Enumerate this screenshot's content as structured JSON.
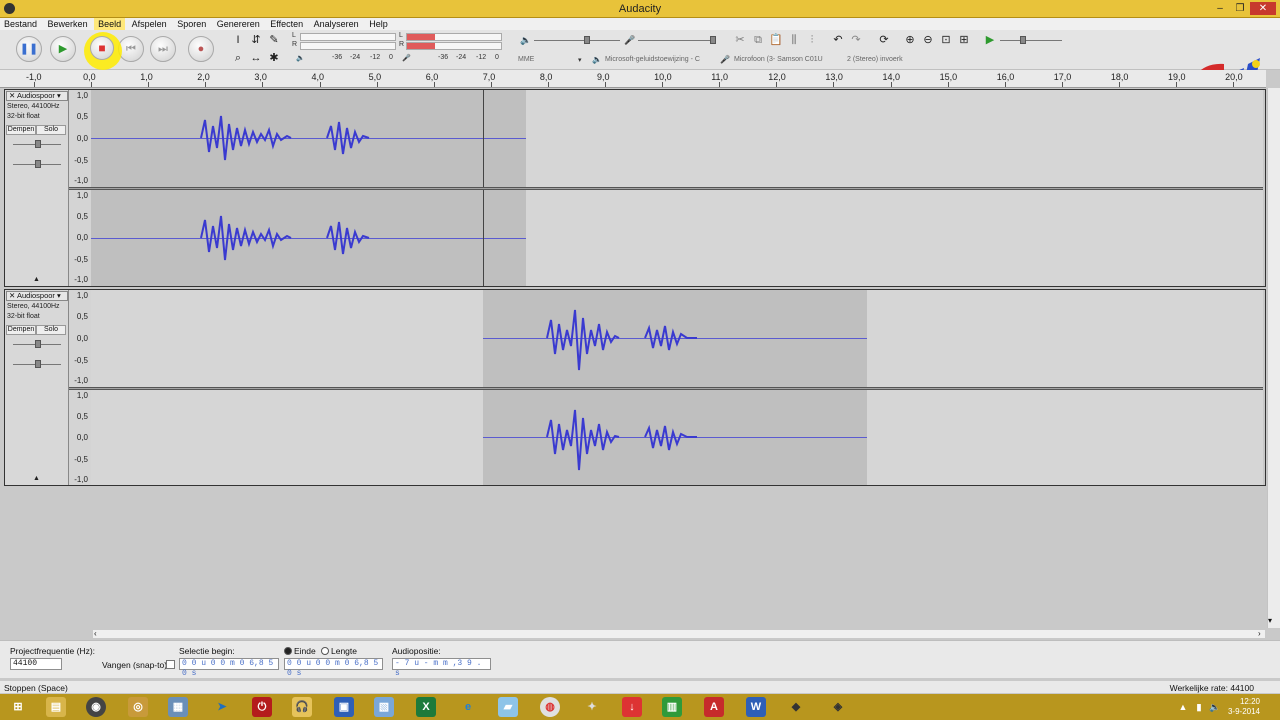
{
  "window": {
    "title": "Audacity",
    "minimize": "–",
    "maximize": "❐",
    "close": "✕"
  },
  "menu": [
    "Bestand",
    "Bewerken",
    "Beeld",
    "Afspelen",
    "Sporen",
    "Genereren",
    "Effecten",
    "Analyseren",
    "Help"
  ],
  "meters": {
    "playback": {
      "left": "L",
      "right": "R"
    },
    "record": {
      "left": "L",
      "right": "R"
    },
    "scale_a": [
      "-36",
      "-24",
      "-12",
      "0"
    ],
    "scale_b": [
      "-36",
      "-24",
      "-12",
      "0"
    ]
  },
  "devices": {
    "host": "MME",
    "output": "Microsoft-geluidstoewijzing - C",
    "input": "Microfoon (3- Samson C01U",
    "channels": "2 (Stereo) invoerk"
  },
  "ruler_ticks": [
    "-1,0",
    "0,0",
    "1,0",
    "2,0",
    "3,0",
    "4,0",
    "5,0",
    "6,0",
    "7,0",
    "8,0",
    "9,0",
    "10,0",
    "11,0",
    "12,0",
    "13,0",
    "14,0",
    "15,0",
    "16,0",
    "17,0",
    "18,0",
    "19,0",
    "20,0"
  ],
  "tracks": [
    {
      "name": "Audiospoor",
      "rate": "Stereo, 44100Hz",
      "format": "32-bit float",
      "mute": "Dempen",
      "solo": "Solo",
      "scale": [
        "1,0",
        "0,5",
        "0,0",
        "-0,5",
        "-1,0"
      ]
    },
    {
      "name": "Audiospoor",
      "rate": "Stereo, 44100Hz",
      "format": "32-bit float",
      "mute": "Dempen",
      "solo": "Solo",
      "scale": [
        "1,0",
        "0,5",
        "0,0",
        "-0,5",
        "-1,0"
      ]
    }
  ],
  "selection_bar": {
    "project_rate_label": "Projectfrequentie (Hz):",
    "project_rate": "44100",
    "snap_label": "Vangen (snap-to)",
    "start_label": "Selectie begin:",
    "start_value": "0 0 u 0 0 m 0 6,8 5 0 s",
    "end_label": "Einde",
    "length_label": "Lengte",
    "end_value": "0 0 u 0 0 m 0 6,8 5 0 s",
    "audio_pos_label": "Audiopositie:",
    "audio_pos_value": "- 7 u - m m ,3 9 . s"
  },
  "status": {
    "left": "Stoppen (Space)",
    "right": "Werkelijke rate: 44100"
  },
  "taskbar": {
    "time": "12:20",
    "date": "3-9-2014"
  },
  "colors": {
    "waveform": "#3a3ad0",
    "titlebar": "#e8c33a",
    "taskbar": "#b8961e",
    "highlight": "#ffec00"
  }
}
